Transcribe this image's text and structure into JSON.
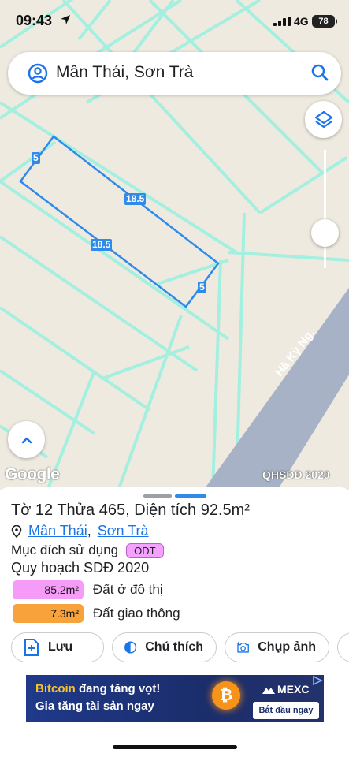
{
  "status": {
    "time": "09:43",
    "network": "4G",
    "battery": "78"
  },
  "search": {
    "text": "Mân Thái, Sơn Trà"
  },
  "map": {
    "dims": {
      "top_left": "5",
      "top": "18.5",
      "bottom": "18.5",
      "right": "5"
    },
    "road_name": "Hà Kỳ Ng.",
    "logo": "Google",
    "source": "QHSDĐ 2020"
  },
  "parcel": {
    "title": "Tờ 12 Thửa 465, Diện tích 92.5m²",
    "ward": "Mân Thái",
    "district": "Sơn Trà",
    "separator": ",",
    "purpose_label": "Mục đích sử dụng",
    "purpose_code": "ODT",
    "plan_title": "Quy hoạch SDĐ 2020",
    "areas": [
      {
        "value": "85.2m²",
        "label": "Đất ở đô thị",
        "color": "#f59bf8"
      },
      {
        "value": "7.3m²",
        "label": "Đất giao thông",
        "color": "#f7a23a"
      }
    ]
  },
  "actions": {
    "save": "Lưu",
    "legend": "Chú thích",
    "photo": "Chụp ảnh"
  },
  "ad": {
    "line1_highlight": "Bitcoin",
    "line1_rest": " đang tăng vọt!",
    "line2": "Gia tăng tài sản ngay",
    "coin_symbol": "₿",
    "brand": "MEXC",
    "cta": "Bắt đầu ngay"
  },
  "colors": {
    "accent": "#1a73e8",
    "parcel_outline": "#2f8bea",
    "map_lines": "#9ff0e0",
    "road": "#a7b2c6"
  }
}
